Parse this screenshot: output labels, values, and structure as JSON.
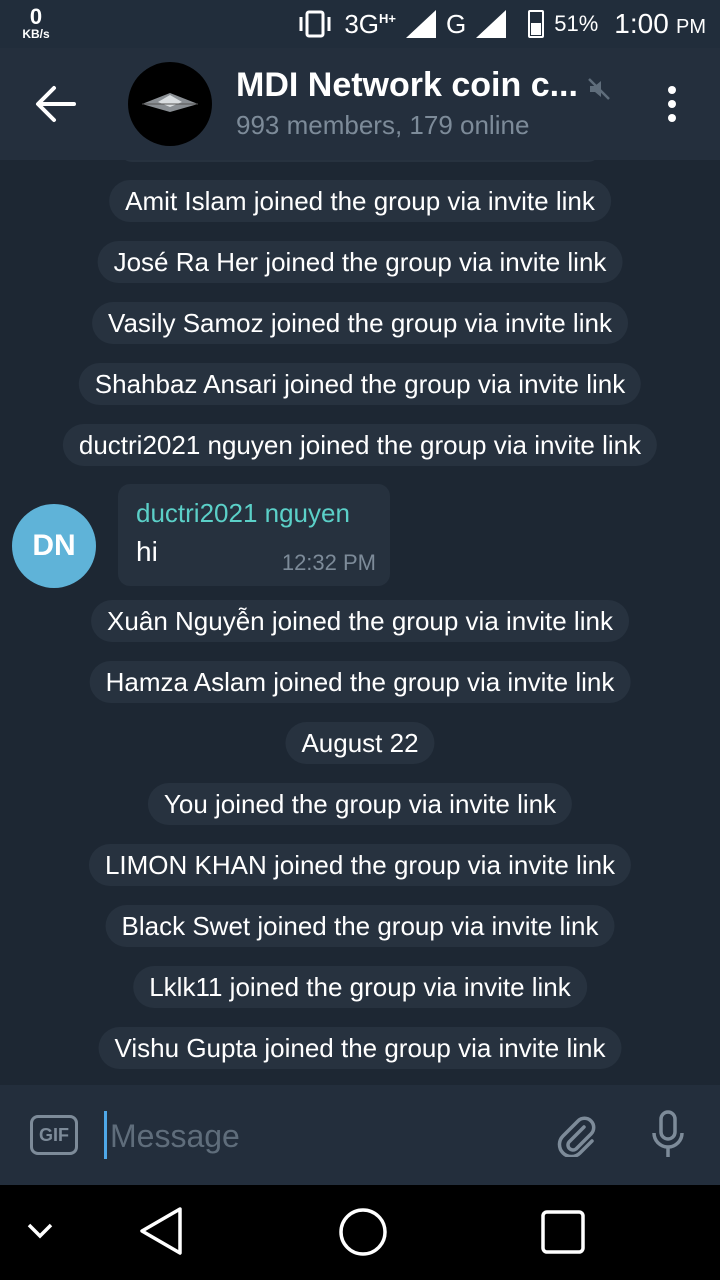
{
  "status_bar": {
    "speed_value": "0",
    "speed_unit": "KB/s",
    "network_3g": "3G",
    "network_h": "H+",
    "network_g": "G",
    "battery": "51%",
    "time": "1:00",
    "ampm": "PM",
    "icons": [
      "vibrate-icon",
      "signal-icon",
      "battery-icon"
    ]
  },
  "header": {
    "title": "MDI Network coin c...",
    "subtitle": "993 members, 179 online",
    "icons": [
      "back-arrow-icon",
      "muted-icon",
      "more-vert-icon"
    ]
  },
  "messages": {
    "service_top": [
      "Amit Islam joined the group via invite link",
      "José Ra Her joined the group via invite link",
      "Vasily Samoz joined the group via invite link",
      "Shahbaz Ansari joined the group via invite link",
      "ductri2021 nguyen joined the group via invite link"
    ],
    "chat_message": {
      "avatar_initials": "DN",
      "sender": "ductri2021 nguyen",
      "text": "hi",
      "time": "12:32 PM"
    },
    "service_mid": [
      "Xuân Nguyễn joined the group via invite link",
      "Hamza Aslam joined the group via invite link"
    ],
    "date_separator": "August 22",
    "service_bottom": [
      "You joined the group via invite link",
      "LIMON KHAN joined the group via invite link",
      "Black Swet joined the group via invite link",
      "Lklk11 joined the group via invite link",
      "Vishu Gupta joined the group via invite link"
    ]
  },
  "composer": {
    "gif_label": "GIF",
    "placeholder": "Message",
    "icons": [
      "attach-icon",
      "mic-icon"
    ]
  },
  "colors": {
    "background": "#1d2733",
    "header": "#242f3d",
    "pill": "#27323f",
    "sender_name": "#5bd0c8",
    "avatar": "#5fb3d8",
    "cursor": "#4fa8e8"
  }
}
